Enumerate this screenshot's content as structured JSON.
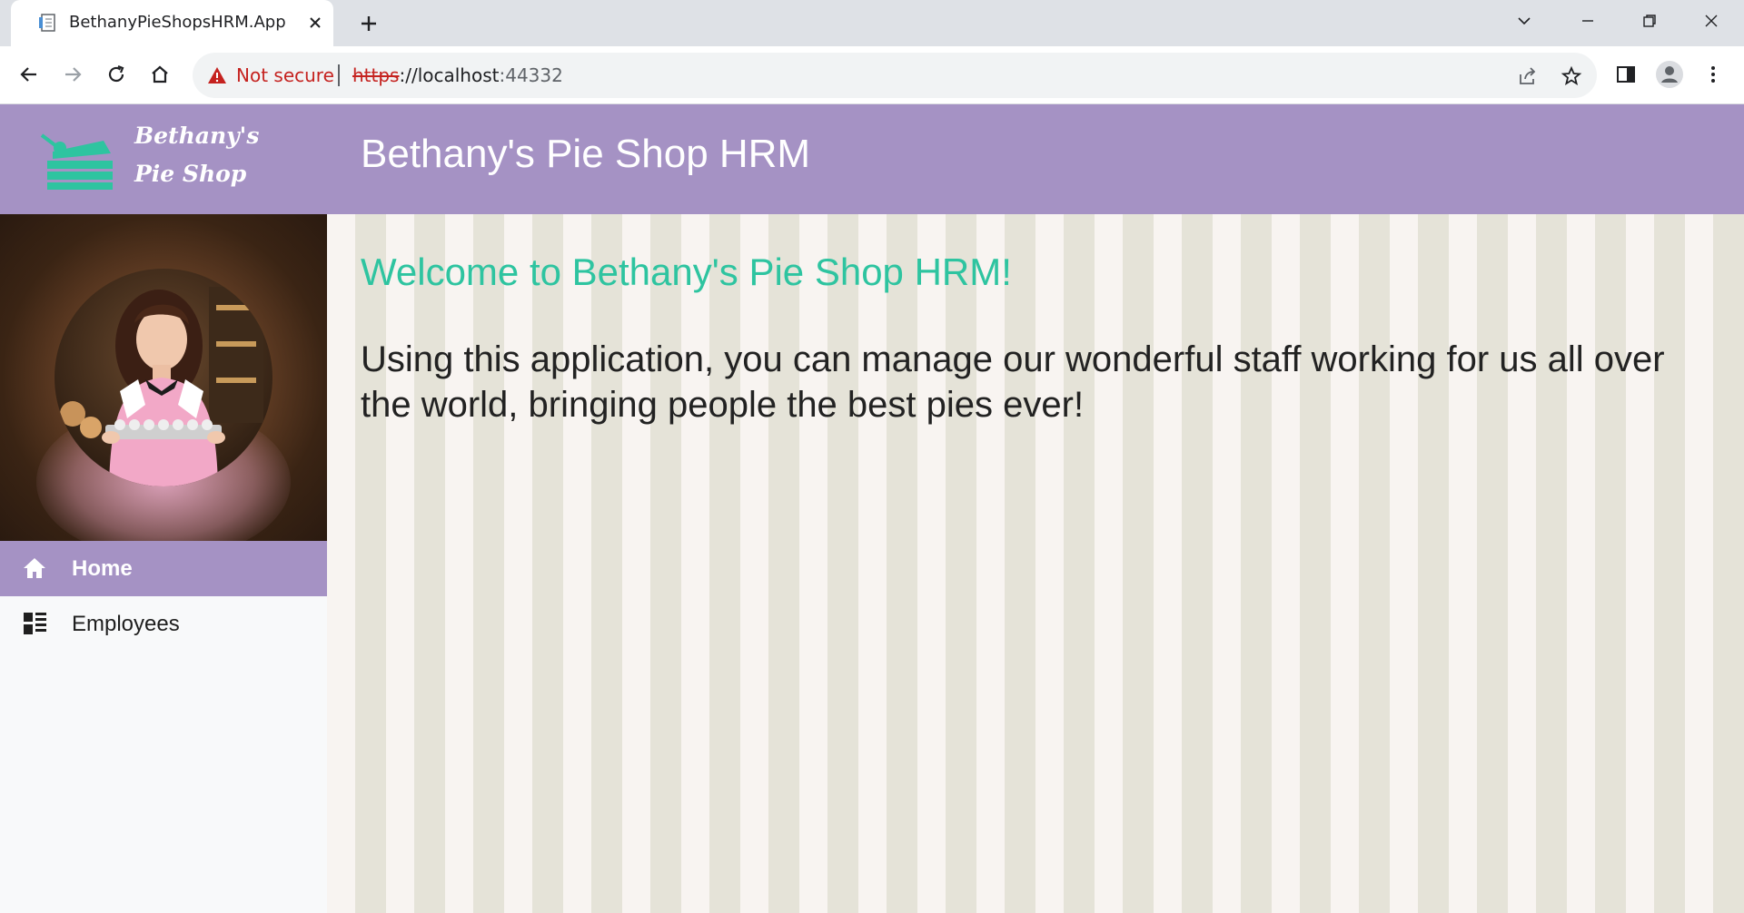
{
  "browser": {
    "tab_title": "BethanyPieShopsHRM.App",
    "security_label": "Not secure",
    "url_scheme": "https",
    "url_rest": "://localhost",
    "url_port": ":44332"
  },
  "header": {
    "logo_line1": "Bethany's",
    "logo_line2": "Pie Shop",
    "title": "Bethany's Pie Shop HRM"
  },
  "sidebar": {
    "items": [
      {
        "label": "Home",
        "icon": "home-icon",
        "active": true
      },
      {
        "label": "Employees",
        "icon": "list-icon",
        "active": false
      }
    ]
  },
  "main": {
    "welcome": "Welcome to Bethany's Pie Shop HRM!",
    "intro": "Using this application, you can manage our wonderful staff working for us all over the world, bringing people the best pies ever!"
  },
  "colors": {
    "header_bg": "#a592c4",
    "accent_teal": "#2ec4a0",
    "stripe_light": "#f8f4f1",
    "stripe_dark": "#e5e3d8"
  }
}
